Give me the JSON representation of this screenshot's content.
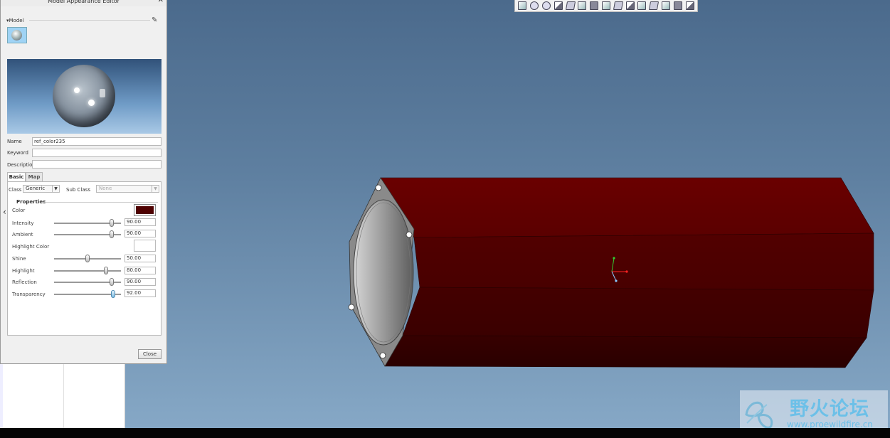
{
  "dialog": {
    "title": "Model Appearance Editor",
    "close_glyph": "✕",
    "model_section": "Model",
    "name_label": "Name",
    "name_value": "ref_color235",
    "keyword_label": "Keyword",
    "keyword_value": "",
    "description_label": "Description",
    "description_value": "",
    "tabs": [
      {
        "label": "Basic"
      },
      {
        "label": "Map"
      }
    ],
    "class_label": "Class",
    "class_value": "Generic",
    "subclass_label": "Sub Class",
    "subclass_value": "None",
    "properties_label": "Properties",
    "color_label": "Color",
    "color_value": "#4e0000",
    "highlight_color_label": "Highlight Color",
    "sliders": [
      {
        "label": "Intensity",
        "value": "90.00"
      },
      {
        "label": "Ambient",
        "value": "90.00"
      },
      {
        "label": "Shine",
        "value": "50.00"
      },
      {
        "label": "Highlight",
        "value": "80.00"
      },
      {
        "label": "Reflection",
        "value": "90.00"
      },
      {
        "label": "Transparency",
        "value": "92.00"
      }
    ],
    "close_button": "Close"
  },
  "toolbar": {
    "icons": [
      "refit-icon",
      "zoom-in-icon",
      "zoom-out-icon",
      "repaint-icon",
      "display-style-icon",
      "saved-views-icon",
      "reorient-icon",
      "view-manager-icon",
      "datum-planes-icon",
      "datum-axes-icon",
      "datum-points-icon",
      "coord-sys-icon",
      "annotations-icon",
      "spin-center-icon",
      "layers-icon"
    ]
  },
  "watermark": {
    "text": "野火论坛",
    "url": "www.proewildfire.cn"
  }
}
